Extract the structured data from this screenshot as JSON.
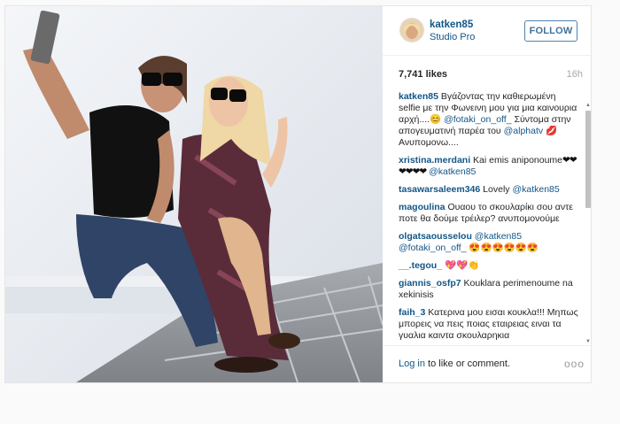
{
  "post": {
    "username": "katken85",
    "location": "Studio Pro",
    "follow_label": "FOLLOW",
    "likes": "7,741 likes",
    "time": "16h"
  },
  "comments": [
    {
      "user": "katken85",
      "text": "Βγάζοντας την καθιερωμένη selfie με την Φωνεινη μου για μια καινουρια αρχή....",
      "emoji": "😊",
      "mention": "@fotaki_on_off_",
      "text2": "Σύντομα στην απογευματινή παρέα του",
      "mention2": "@alphatv",
      "emoji2": "💋",
      "text3": "Ανυπομονω...."
    },
    {
      "user": "xristina.merdani",
      "text": "Kai emis aniponoume",
      "hearts": "❤❤❤❤❤❤",
      "mention": "@katken85"
    },
    {
      "user": "tasawarsaleem346",
      "text": "Lovely",
      "mention": "@katken85"
    },
    {
      "user": "magoulina",
      "text": "Ουαου το σκουλαρίκι σου αντε ποτε θα δούμε τρέιλερ? ανυπομονούμε"
    },
    {
      "user": "olgatsaousselou",
      "mention": "@katken85",
      "mention2": "@fotaki_on_off_",
      "emoji": "😍😍😍😍😍😍"
    },
    {
      "user": "__.tegou_",
      "emoji": "💖💖",
      "emoji2": "👏"
    },
    {
      "user": "giannis_osfp7",
      "text": "Kouklara perimenoume na xekinisis"
    },
    {
      "user": "faih_3",
      "text": "Κατερινα μου εισαι κουκλα!!! Μηπως μπορεις να πεις ποιας εταιρειας ειναι τα γυαλια καιντα σκουλαρηκια"
    }
  ],
  "footer": {
    "login_link": "Log in",
    "login_rest": " to like or comment.",
    "more": "ooo"
  }
}
